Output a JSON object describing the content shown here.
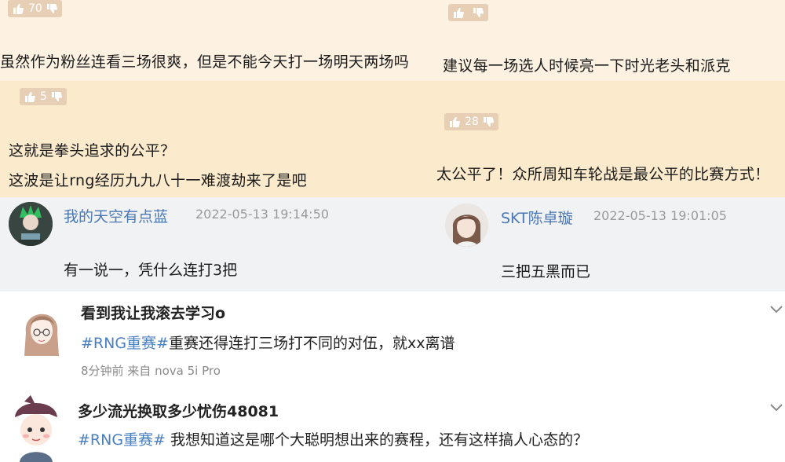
{
  "danmu_top": {
    "left": {
      "likes": "70",
      "text": "虽然作为粉丝连看三场很爽，但是不能今天打一场明天两场吗"
    },
    "right": {
      "likes": "",
      "text": "建议每一场选人时候亮一下时光老头和派克"
    }
  },
  "danmu_mid": {
    "left": {
      "likes": "5",
      "line1": "这就是拳头追求的公平？",
      "line2": "这波是让rng经历九九八十一难渡劫来了是吧"
    },
    "right": {
      "likes": "28",
      "text": "太公平了！众所周知车轮战是最公平的比赛方式！"
    }
  },
  "comments": [
    {
      "user": "我的天空有点蓝",
      "time": "2022-05-13 19:14:50",
      "text": "有一说一，凭什么连打3把"
    },
    {
      "user": "SKT陈卓璇",
      "time": "2022-05-13 19:01:05",
      "text": "三把五黑而已"
    }
  ],
  "weibo": [
    {
      "user": "看到我让我滚去学习o",
      "tag": "#RNG重赛#",
      "text": "重赛还得连打三场打不同的对伍，就xx离谱",
      "meta": "8分钟前  来自 nova 5i Pro"
    },
    {
      "user": "多少流光换取多少忧伤48081",
      "tag": "#RNG重赛#",
      "text": " 我想知道这是哪个大聪明想出来的赛程，还有这样搞人心态的？"
    }
  ],
  "colors": {
    "panel_light": "#fdf2e2",
    "panel_dark": "#fbeacc",
    "comment_bg": "#f1f2f4",
    "pill": "#e6cfb5",
    "link": "#4a7fc1"
  },
  "icons": [
    "thumbs-up-icon",
    "thumbs-down-icon",
    "chevron-down-icon",
    "avatar"
  ]
}
